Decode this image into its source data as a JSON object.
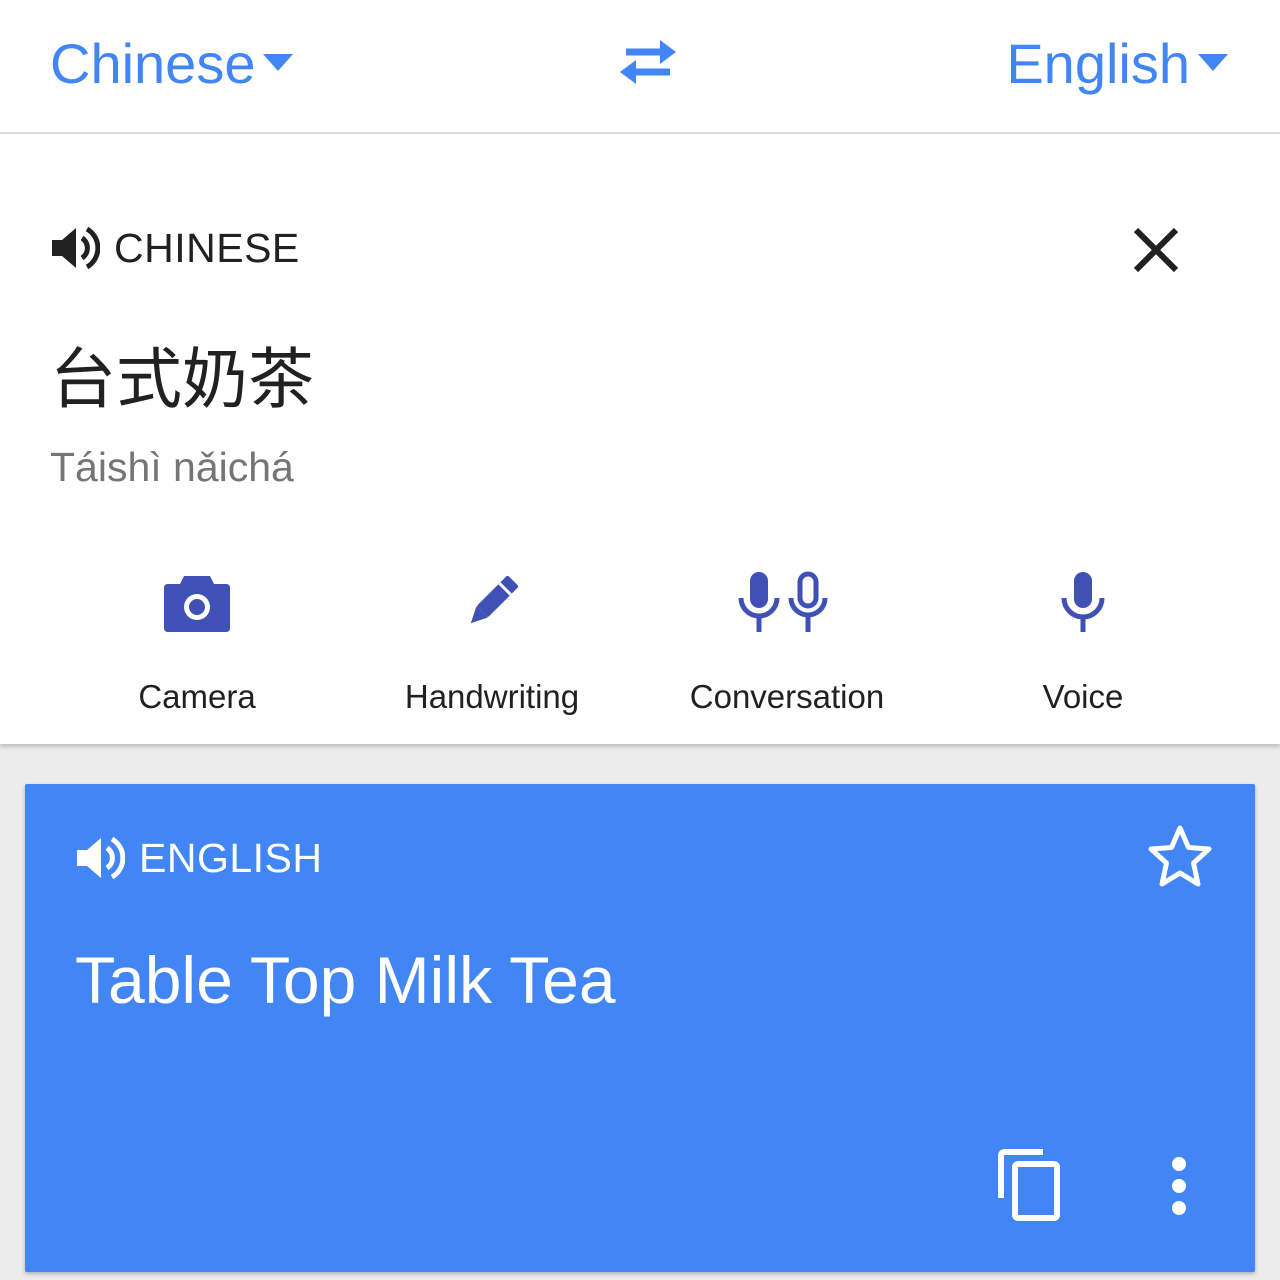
{
  "header": {
    "source_language": "Chinese",
    "target_language": "English"
  },
  "input": {
    "language_label": "CHINESE",
    "text": "台式奶茶",
    "romanization": "Táishì nǎichá"
  },
  "input_tools": [
    {
      "label": "Camera",
      "icon": "camera-icon"
    },
    {
      "label": "Handwriting",
      "icon": "pen-icon"
    },
    {
      "label": "Conversation",
      "icon": "two-microphones-icon"
    },
    {
      "label": "Voice",
      "icon": "microphone-icon"
    }
  ],
  "result": {
    "language_label": "ENGLISH",
    "text": "Table Top Milk Tea"
  },
  "colors": {
    "accent": "#4285f4",
    "tool_icon": "#3f51b5",
    "result_background": "#4285f4",
    "text_primary": "#212121",
    "text_secondary": "#757575"
  }
}
